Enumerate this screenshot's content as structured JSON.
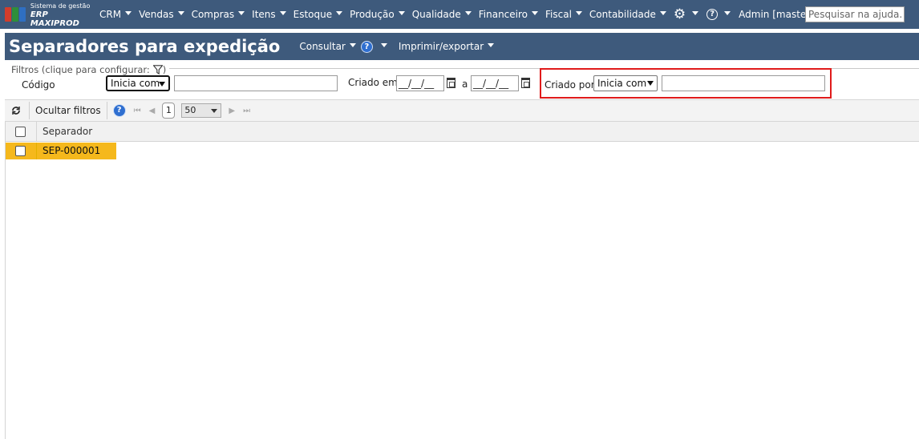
{
  "app": {
    "logo_line1": "Sistema de gestão",
    "logo_line2": "ERP MAXIPROD"
  },
  "nav": {
    "items": [
      "CRM",
      "Vendas",
      "Compras",
      "Itens",
      "Estoque",
      "Produção",
      "Qualidade",
      "Financeiro",
      "Fiscal",
      "Contabilidade"
    ],
    "settings_icon": "gear-icon",
    "help_icon": "question-circle-icon",
    "help_glyph": "?",
    "user": "Admin [master]",
    "search_placeholder": "Pesquisar na ajuda..."
  },
  "title": {
    "text": "Separadores para expedição",
    "consult_label": "Consultar",
    "help_glyph": "?",
    "print_label": "Imprimir/exportar"
  },
  "filters": {
    "legend": "Filtros (clique para configurar:",
    "legend_close": ")",
    "codigo_label": "Código",
    "codigo_mode": "Inicia com",
    "codigo_value": "",
    "criado_em_label": "Criado em",
    "date_from": "__/__/__",
    "date_separator": "a",
    "date_to": "__/__/__",
    "criado_por_label": "Criado por",
    "criado_por_mode": "Inicia com",
    "criado_por_value": ""
  },
  "toolbar": {
    "refresh_icon": "refresh-icon",
    "hide_filters_label": "Ocultar filtros",
    "help_glyph": "?",
    "first_glyph": "⏮",
    "prev_glyph": "◀",
    "page": "1",
    "next_glyph": "▶",
    "last_glyph": "⏭",
    "page_size": "50"
  },
  "grid": {
    "columns": [
      "Separador"
    ],
    "rows": [
      {
        "separador": "SEP-000001",
        "selected": true
      }
    ]
  },
  "colors": {
    "header_bg": "#3e5a7c",
    "selected_row": "#f5b81c",
    "highlight_border": "#e01b1b"
  }
}
